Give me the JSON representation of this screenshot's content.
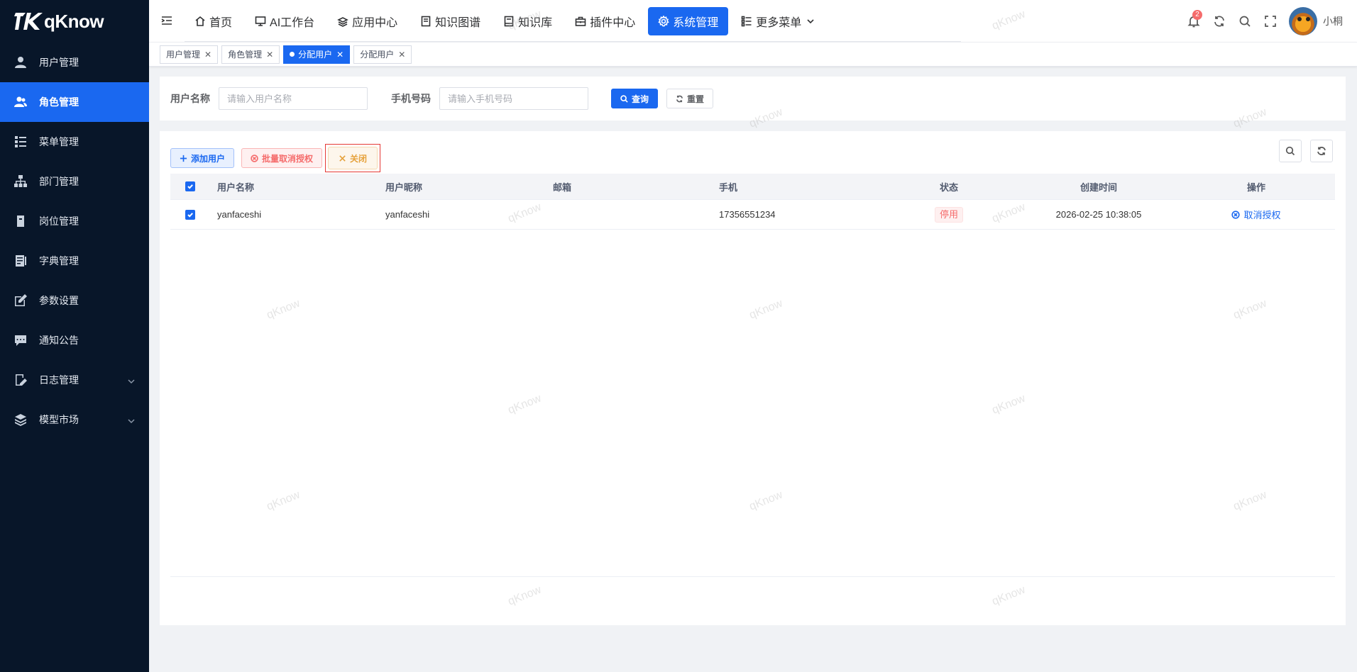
{
  "app": {
    "logo_text": "qKnow",
    "user_name": "小桐",
    "notification_count": "2",
    "watermark": "qKnow"
  },
  "sidebar": {
    "items": [
      {
        "label": "用户管理",
        "icon": "user-icon",
        "active": false
      },
      {
        "label": "角色管理",
        "icon": "peoples-icon",
        "active": true
      },
      {
        "label": "菜单管理",
        "icon": "tree-table-icon",
        "active": false
      },
      {
        "label": "部门管理",
        "icon": "tree-icon",
        "active": false
      },
      {
        "label": "岗位管理",
        "icon": "post-icon",
        "active": false
      },
      {
        "label": "字典管理",
        "icon": "dict-icon",
        "active": false
      },
      {
        "label": "参数设置",
        "icon": "edit-icon",
        "active": false
      },
      {
        "label": "通知公告",
        "icon": "message-icon",
        "active": false
      },
      {
        "label": "日志管理",
        "icon": "log-icon",
        "active": false,
        "has_children": true
      },
      {
        "label": "模型市场",
        "icon": "model-icon",
        "active": false,
        "has_children": true
      }
    ]
  },
  "topnav": {
    "items": [
      {
        "label": "首页",
        "icon": "home-icon"
      },
      {
        "label": "AI工作台",
        "icon": "monitor-icon"
      },
      {
        "label": "应用中心",
        "icon": "app-icon"
      },
      {
        "label": "知识图谱",
        "icon": "doc-icon"
      },
      {
        "label": "知识库",
        "icon": "book-icon"
      },
      {
        "label": "插件中心",
        "icon": "plugin-icon"
      },
      {
        "label": "系统管理",
        "icon": "gear-icon",
        "active": true
      },
      {
        "label": "更多菜单",
        "icon": "tree-table-icon",
        "dropdown": true
      }
    ]
  },
  "tags": [
    {
      "label": "用户管理",
      "active": false
    },
    {
      "label": "角色管理",
      "active": false
    },
    {
      "label": "分配用户",
      "active": true
    },
    {
      "label": "分配用户",
      "active": false
    }
  ],
  "search": {
    "username_label": "用户名称",
    "username_placeholder": "请输入用户名称",
    "phone_label": "手机号码",
    "phone_placeholder": "请输入手机号码",
    "query_label": "查询",
    "reset_label": "重置"
  },
  "toolbar": {
    "add_label": "添加用户",
    "batch_cancel_label": "批量取消授权",
    "close_label": "关闭"
  },
  "table": {
    "headers": {
      "username": "用户名称",
      "nickname": "用户昵称",
      "email": "邮箱",
      "phone": "手机",
      "status": "状态",
      "created": "创建时间",
      "ops": "操作"
    },
    "rows": [
      {
        "username": "yanfaceshi",
        "nickname": "yanfaceshi",
        "email": "",
        "phone": "17356551234",
        "status": "停用",
        "created": "2026-02-25 10:38:05",
        "op": "取消授权",
        "checked": true
      }
    ]
  },
  "colors": {
    "primary": "#1a68f0",
    "sidebar_bg": "#081629",
    "danger": "#f56c6c",
    "warning": "#e6a23c"
  }
}
